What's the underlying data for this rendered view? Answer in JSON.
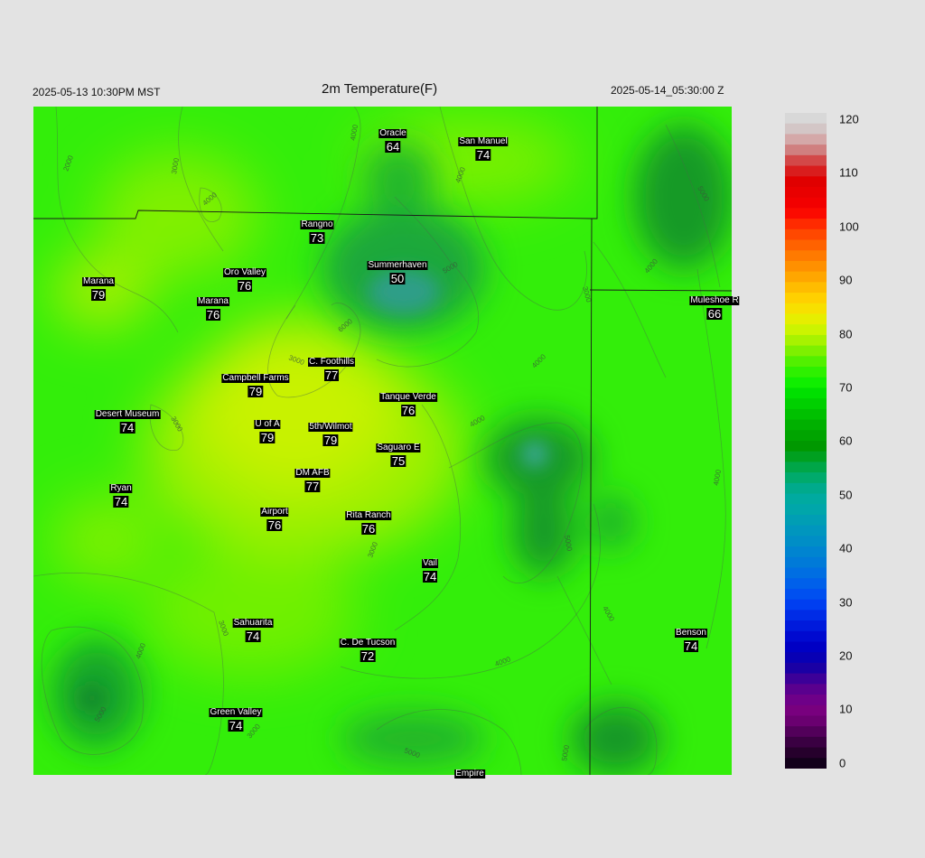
{
  "header": {
    "local_time": "2025-05-13 10:30PM MST",
    "title": "2m Temperature(F)",
    "valid_time": "2025-05-14_05:30:00 Z"
  },
  "stations": [
    {
      "name": "Oracle",
      "value": "64"
    },
    {
      "name": "San Manuel",
      "value": "74"
    },
    {
      "name": "Rangno",
      "value": "73"
    },
    {
      "name": "Summerhaven",
      "value": "50"
    },
    {
      "name": "Marana",
      "value": "79"
    },
    {
      "name": "Oro Valley",
      "value": "76"
    },
    {
      "name": "Marana",
      "value": "76"
    },
    {
      "name": "Muleshoe R",
      "value": "66"
    },
    {
      "name": "C. Foothills",
      "value": "77"
    },
    {
      "name": "Campbell Farms",
      "value": "79"
    },
    {
      "name": "Tanque Verde",
      "value": "76"
    },
    {
      "name": "Desert Museum",
      "value": "74"
    },
    {
      "name": "U of A",
      "value": "79"
    },
    {
      "name": "5th/Wilmot",
      "value": "79"
    },
    {
      "name": "Saguaro E",
      "value": "75"
    },
    {
      "name": "DM AFB",
      "value": "77"
    },
    {
      "name": "Ryan",
      "value": "74"
    },
    {
      "name": "Airport",
      "value": "76"
    },
    {
      "name": "Rita Ranch",
      "value": "76"
    },
    {
      "name": "Vail",
      "value": "74"
    },
    {
      "name": "Sahuarita",
      "value": "74"
    },
    {
      "name": "C. De Tucson",
      "value": "72"
    },
    {
      "name": "Benson",
      "value": "74"
    },
    {
      "name": "Green Valley",
      "value": "74"
    },
    {
      "name": "Empire",
      "value": ""
    }
  ],
  "contour_labels": [
    "2000",
    "3000",
    "4000",
    "5000",
    "6000"
  ],
  "colorbar": {
    "ticks": [
      "120",
      "110",
      "100",
      "90",
      "80",
      "70",
      "60",
      "50",
      "40",
      "30",
      "20",
      "10",
      "0"
    ]
  }
}
